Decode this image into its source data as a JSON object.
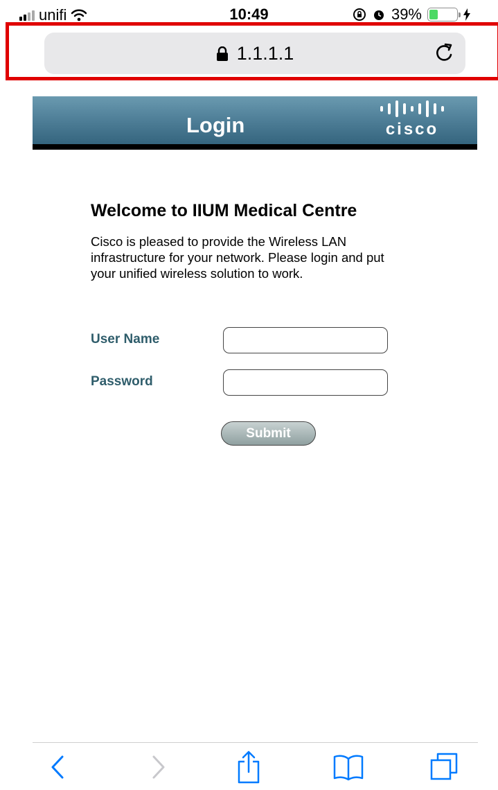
{
  "status_bar": {
    "carrier": "unifi",
    "time": "10:49",
    "battery_percent": "39%",
    "battery_level": 0.39,
    "battery_color": "#4cd964"
  },
  "address_bar": {
    "url": "1.1.1.1",
    "lock_icon": "lock-icon",
    "reload_icon": "reload-icon"
  },
  "header": {
    "title": "Login",
    "logo_text": "cisco"
  },
  "main": {
    "heading": "Welcome to IIUM Medical Centre",
    "intro": "Cisco is pleased to provide the Wireless LAN infrastructure for your network. Please login and put your unified wireless solution to work.",
    "username_label": "User Name",
    "password_label": "Password",
    "username_value": "",
    "password_value": "",
    "submit_label": "Submit"
  },
  "toolbar": {
    "items": [
      "back-icon",
      "forward-icon",
      "share-icon",
      "bookmarks-icon",
      "tabs-icon"
    ]
  },
  "colors": {
    "accent": "#2f5d6b",
    "ios_blue": "#007aff",
    "annotation": "#e00000"
  }
}
